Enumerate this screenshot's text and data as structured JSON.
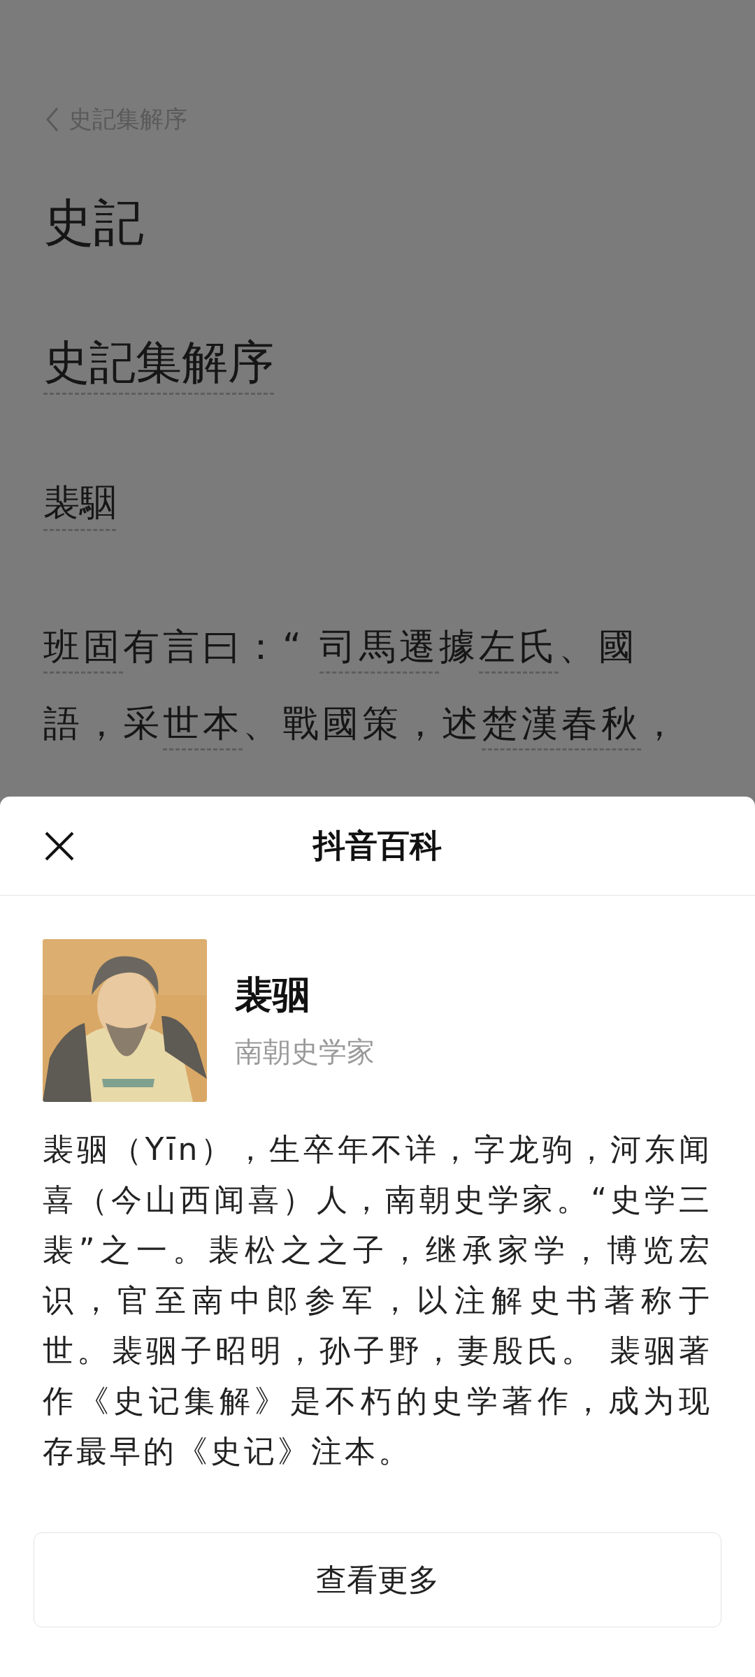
{
  "page": {
    "back_label": "史記集解序",
    "book_title": "史記",
    "chapter_title": {
      "text": "史記集解序",
      "link": true
    },
    "author": {
      "text": "裴駰",
      "link": true
    },
    "paragraph": [
      {
        "text": "班固",
        "link": true
      },
      {
        "text": "有言曰：“ ",
        "link": false
      },
      {
        "text": "司馬遷",
        "link": true
      },
      {
        "text": "據",
        "link": false
      },
      {
        "text": "左氏",
        "link": true
      },
      {
        "text": "、國語，采",
        "link": false
      },
      {
        "text": "世本",
        "link": true
      },
      {
        "text": "、戰國策，述",
        "link": false
      },
      {
        "text": "楚漢春秋",
        "link": true
      },
      {
        "text": "，",
        "link": false
      }
    ]
  },
  "sheet": {
    "title": "抖音百科",
    "entry": {
      "name": "裴骃",
      "subtitle": "南朝史学家"
    },
    "description": "裴骃（Yīn），生卒年不详，字龙驹，河东闻喜（今山西闻喜）人，南朝史学家。“史学三裴”之一。裴松之之子，继承家学，博览宏识，官至南中郎参军，以注解史书著称于世。裴骃子昭明，孙子野，妻殷氏。 裴骃著作《史记集解》是不朽的史学著作，成为现存最早的《史记》注本。",
    "more_button": "查看更多"
  }
}
